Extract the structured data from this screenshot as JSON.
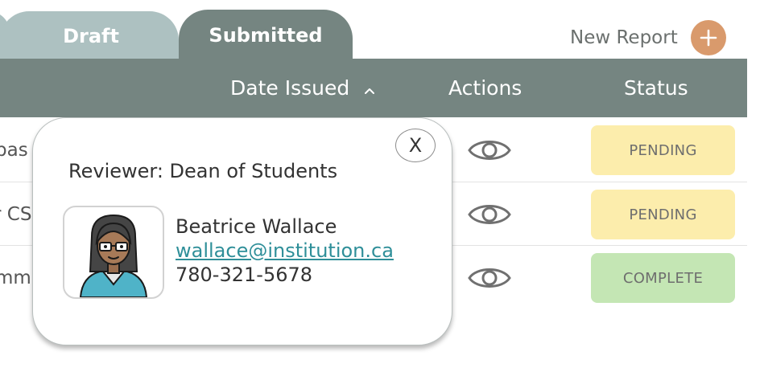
{
  "tabs": [
    {
      "label": ""
    },
    {
      "label": "Draft"
    },
    {
      "label": "Submitted"
    }
  ],
  "new_report": {
    "label": "New Report",
    "icon": "plus-icon"
  },
  "table": {
    "headers": {
      "date_issued": "Date Issued",
      "actions": "Actions",
      "status": "Status"
    },
    "rows": [
      {
        "partial_text": "pas",
        "action_icon": "eye-icon",
        "status": "PENDING"
      },
      {
        "partial_text": "r CS",
        "action_icon": "eye-icon",
        "status": "PENDING"
      },
      {
        "partial_text": "mm",
        "action_icon": "eye-icon",
        "status": "COMPLETE"
      }
    ]
  },
  "popover": {
    "close_label": "X",
    "title": "Reviewer: Dean of Students",
    "name": "Beatrice Wallace",
    "email": "wallace@institution.ca",
    "phone": "780-321-5678"
  },
  "colors": {
    "tab_inactive": "#adc1c1",
    "tab_active": "#758581",
    "accent_orange": "#d99a6c",
    "pending": "#fcedac",
    "complete": "#c4e6b4",
    "link": "#2f8f99"
  }
}
